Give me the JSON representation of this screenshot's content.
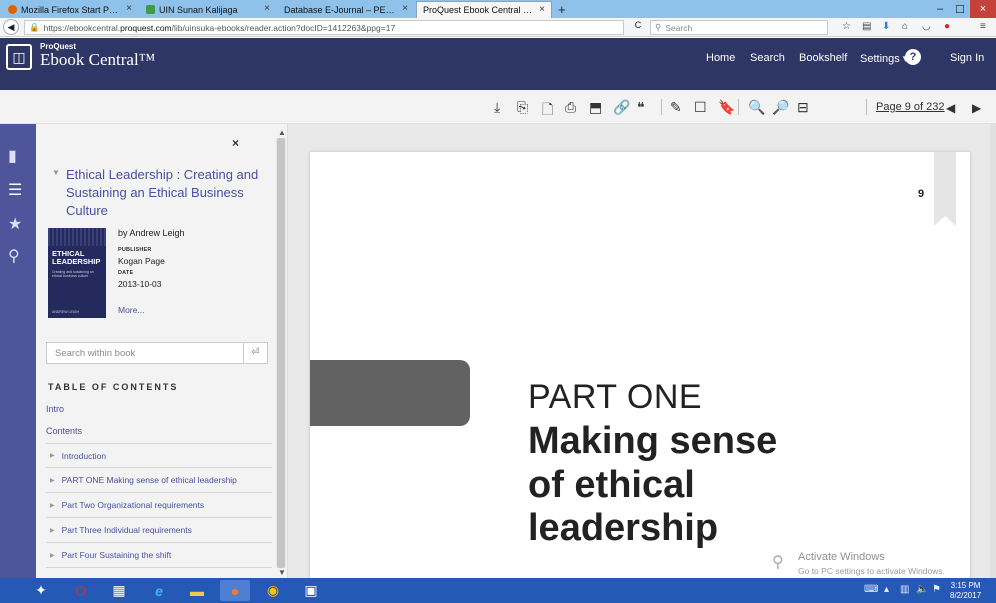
{
  "tabs": [
    {
      "title": "Mozilla Firefox Start Page",
      "color": "#e66000",
      "active": false
    },
    {
      "title": "UIN Sunan Kalijaga",
      "color": "#3e9c46",
      "active": false
    },
    {
      "title": "Database E-Journal – PERPUSTAK",
      "color": "#cccccc",
      "active": false
    },
    {
      "title": "ProQuest Ebook Central Reader",
      "color": "#ffffff",
      "active": true
    }
  ],
  "tab_close": "×",
  "new_tab": "+",
  "window": {
    "minimize": "–",
    "maximize": "☐",
    "close": "×"
  },
  "nav": {
    "back": "◀",
    "url_prefix": "https://ebookcentral.",
    "url_domain": "proquest.com",
    "url_suffix": "/lib/uinsuka-ebooks/reader.action?docID=1412263&ppg=17",
    "reload": "C",
    "search_placeholder": "Search"
  },
  "header": {
    "brand_small": "ProQuest",
    "brand": "Ebook Central™",
    "logo_icon": "◫",
    "nav_items": [
      "Home",
      "Search",
      "Bookshelf",
      "Settings ▾"
    ],
    "help": "?",
    "sign_in": "Sign In"
  },
  "toolbar": {
    "page_indicator": "Page 9 of 232",
    "prev": "◀",
    "next": "▶"
  },
  "panel": {
    "close": "×",
    "book_title": "Ethical Leadership : Creating and Sustaining an Ethical Business Culture",
    "author": "by Andrew Leigh",
    "publisher_label": "PUBLISHER",
    "publisher": "Kogan Page",
    "date_label": "DATE",
    "date": "2013-10-03",
    "more": "More...",
    "search_placeholder": "Search within book",
    "search_button": "⏎",
    "toc_heading": "TABLE OF CONTENTS",
    "toc_links": [
      "Intro",
      "Contents"
    ],
    "toc_items": [
      "Introduction",
      "PART ONE Making sense of ethical leadership",
      "Part Two Organizational requirements",
      "Part Three Individual requirements",
      "Part Four Sustaining the shift"
    ]
  },
  "cover": {
    "title_line1": "ETHICAL",
    "title_line2": "LEADERSHIP",
    "subtitle": "Creating and sustaining an ethical business culture",
    "author": "ANDREW LEIGH"
  },
  "page": {
    "number": "9",
    "part_label": "PART ONE",
    "part_title_lines": [
      "Making sense",
      "of ethical",
      "leadership"
    ]
  },
  "activation": {
    "title": "Activate Windows",
    "subtitle": "Go to PC settings to activate Windows."
  },
  "taskbar": {
    "time": "3:15 PM",
    "date": "8/2/2017"
  },
  "colors": {
    "header_bg": "#2e3665",
    "rail_bg": "#4e559b",
    "link": "#4950a0",
    "taskbar": "#2459b5"
  }
}
